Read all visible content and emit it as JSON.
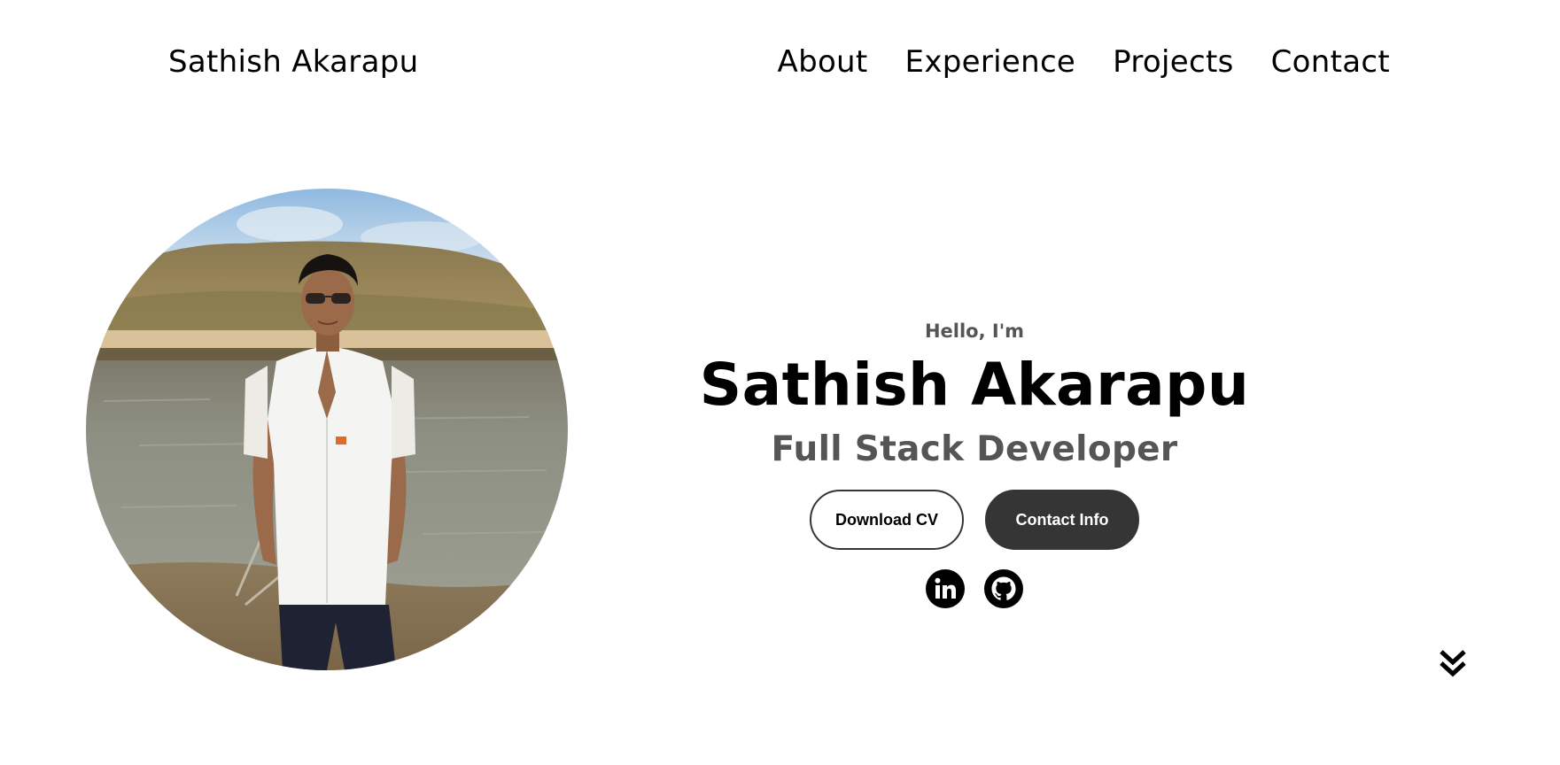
{
  "nav": {
    "logo": "Sathish Akarapu",
    "links": [
      {
        "label": "About"
      },
      {
        "label": "Experience"
      },
      {
        "label": "Projects"
      },
      {
        "label": "Contact"
      }
    ]
  },
  "hero": {
    "greeting": "Hello, I'm",
    "name": "Sathish Akarapu",
    "role": "Full Stack Developer",
    "buttons": {
      "download_cv": "Download CV",
      "contact_info": "Contact Info"
    },
    "socials": [
      {
        "icon": "linkedin-icon"
      },
      {
        "icon": "github-icon"
      }
    ],
    "profile_image_alt": "Profile picture"
  },
  "scroll": {
    "icon": "double-chevron-down-icon"
  },
  "colors": {
    "background": "#ffffff",
    "text": "#000000",
    "muted_text": "#555555",
    "button_dark": "#353535"
  }
}
